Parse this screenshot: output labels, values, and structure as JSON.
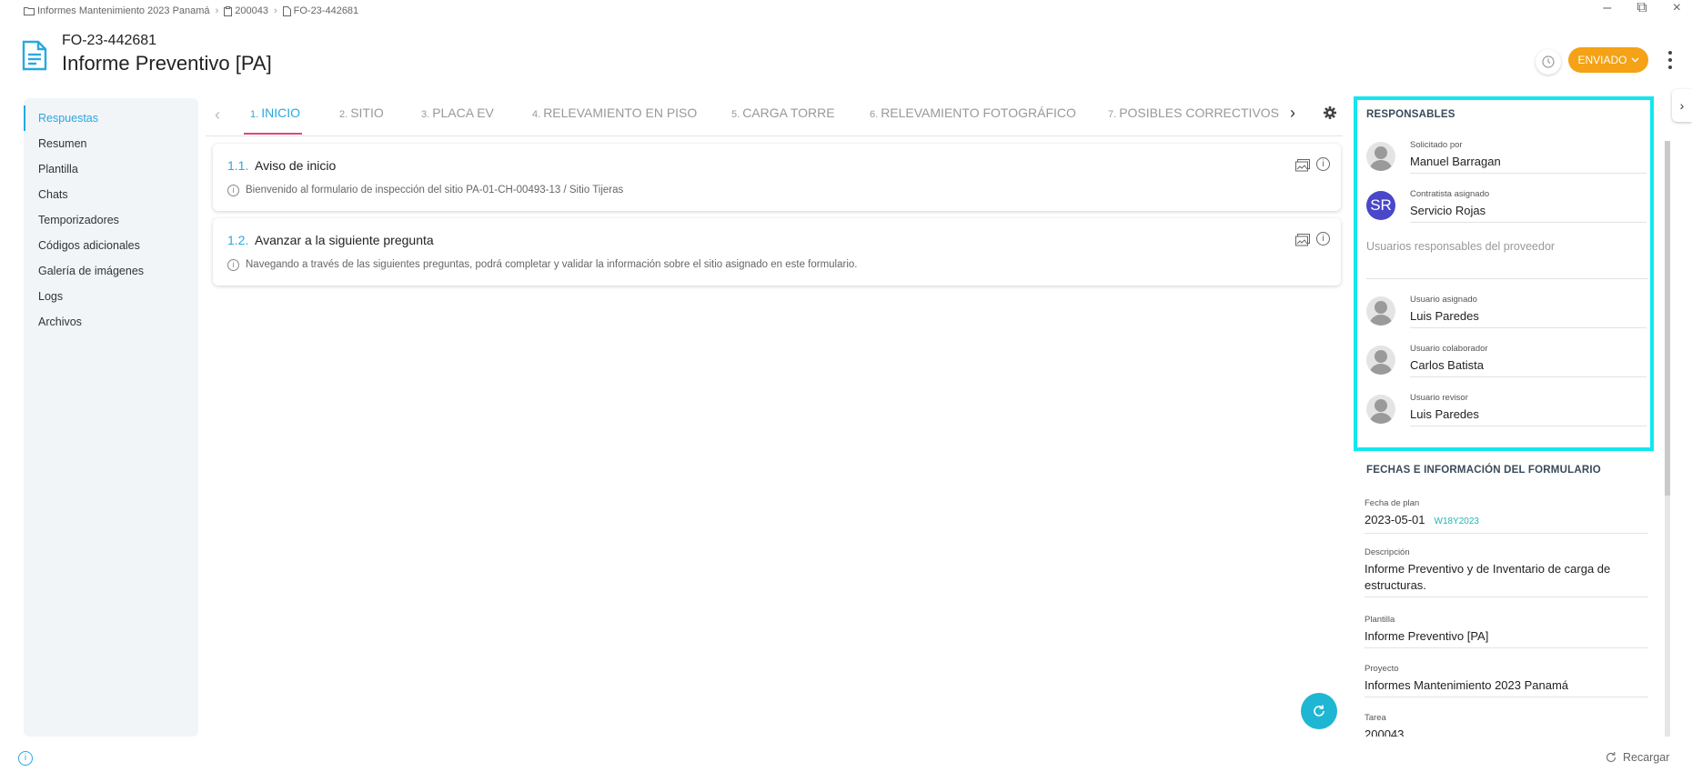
{
  "breadcrumb": {
    "items": [
      "Informes Mantenimiento 2023 Panamá",
      "200043",
      "FO-23-442681"
    ]
  },
  "header": {
    "code": "FO-23-442681",
    "title": "Informe Preventivo [PA]",
    "status_label": "ENVIADO"
  },
  "sidebar": {
    "items": [
      {
        "label": "Respuestas",
        "active": true
      },
      {
        "label": "Resumen"
      },
      {
        "label": "Plantilla"
      },
      {
        "label": "Chats"
      },
      {
        "label": "Temporizadores"
      },
      {
        "label": "Códigos adicionales"
      },
      {
        "label": "Galería de imágenes"
      },
      {
        "label": "Logs"
      },
      {
        "label": "Archivos"
      }
    ]
  },
  "tabs": [
    {
      "num": "1.",
      "label": "INICIO"
    },
    {
      "num": "2.",
      "label": "SITIO"
    },
    {
      "num": "3.",
      "label": "PLACA EV"
    },
    {
      "num": "4.",
      "label": "RELEVAMIENTO EN PISO"
    },
    {
      "num": "5.",
      "label": "CARGA TORRE"
    },
    {
      "num": "6.",
      "label": "RELEVAMIENTO FOTOGRÁFICO"
    },
    {
      "num": "7.",
      "label": "POSIBLES CORRECTIVOS"
    }
  ],
  "questions": [
    {
      "num": "1.1.",
      "title": "Aviso de inicio",
      "desc": "Bienvenido al formulario de inspección del sitio PA-01-CH-00493-13 / Sitio Tijeras"
    },
    {
      "num": "1.2.",
      "title": "Avanzar a la siguiente pregunta",
      "desc": "Navegando a través de las siguientes preguntas, podrá completar y validar la información sobre el sitio asignado en este formulario."
    }
  ],
  "responsables": {
    "title": "RESPONSABLES",
    "requested": {
      "label": "Solicitado por",
      "value": "Manuel Barragan"
    },
    "contractor": {
      "label": "Contratista asignado",
      "value": "Servicio Rojas",
      "initials": "SR"
    },
    "provider_users": "Usuarios responsables del proveedor",
    "assigned": {
      "label": "Usuario asignado",
      "value": "Luis Paredes"
    },
    "collaborator": {
      "label": "Usuario colaborador",
      "value": "Carlos Batista"
    },
    "reviewer": {
      "label": "Usuario revisor",
      "value": "Luis Paredes"
    }
  },
  "form_info": {
    "title": "FECHAS E INFORMACIÓN DEL FORMULARIO",
    "plan_date": {
      "label": "Fecha de plan",
      "value": "2023-05-01",
      "week": "W18Y2023"
    },
    "description": {
      "label": "Descripción",
      "value": "Informe Preventivo y de Inventario de carga de estructuras."
    },
    "template": {
      "label": "Plantilla",
      "value": "Informe Preventivo [PA]"
    },
    "project": {
      "label": "Proyecto",
      "value": "Informes Mantenimiento 2023 Panamá"
    },
    "task": {
      "label": "Tarea",
      "value": "200043"
    }
  },
  "footer": {
    "reload_label": "Recargar"
  },
  "colors": {
    "accent": "#29a8e0",
    "status": "#f5a216",
    "highlight": "#11e7ee",
    "tab_underline": "#e0457b"
  }
}
